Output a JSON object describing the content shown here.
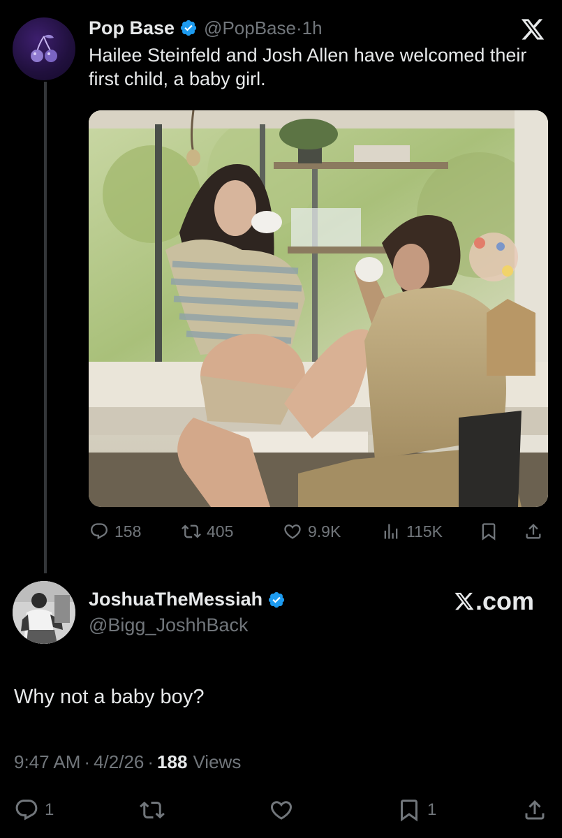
{
  "colors": {
    "background": "#000000",
    "text": "#e7e9ea",
    "muted": "#71767b",
    "verified": "#1d9bf0",
    "thread_line": "#333639"
  },
  "tweet": {
    "author_name": "Pop Base",
    "handle": "@PopBase",
    "separator": "·",
    "time": "1h",
    "text": "Hailee Steinfeld and Josh Allen have welcomed their first child, a baby girl.",
    "stats": {
      "replies": "158",
      "retweets": "405",
      "likes": "9.9K",
      "views": "115K"
    },
    "icons": [
      "cherry-avatar-icon",
      "verified-badge-icon",
      "x-logo-icon",
      "reply-icon",
      "retweet-icon",
      "like-icon",
      "views-icon",
      "bookmark-icon",
      "share-icon"
    ]
  },
  "reply": {
    "author_name": "JoshuaTheMessiah",
    "handle": "@Bigg_JoshhBack",
    "text": "Why not a baby boy?",
    "time": "9:47 AM",
    "sep1": "·",
    "date": "4/2/26",
    "sep2": "·",
    "views_count": "188",
    "views_label": "Views",
    "stats": {
      "replies": "1",
      "bookmarks": "1"
    }
  },
  "watermark": "X.com",
  "watermark_suffix": ".com"
}
